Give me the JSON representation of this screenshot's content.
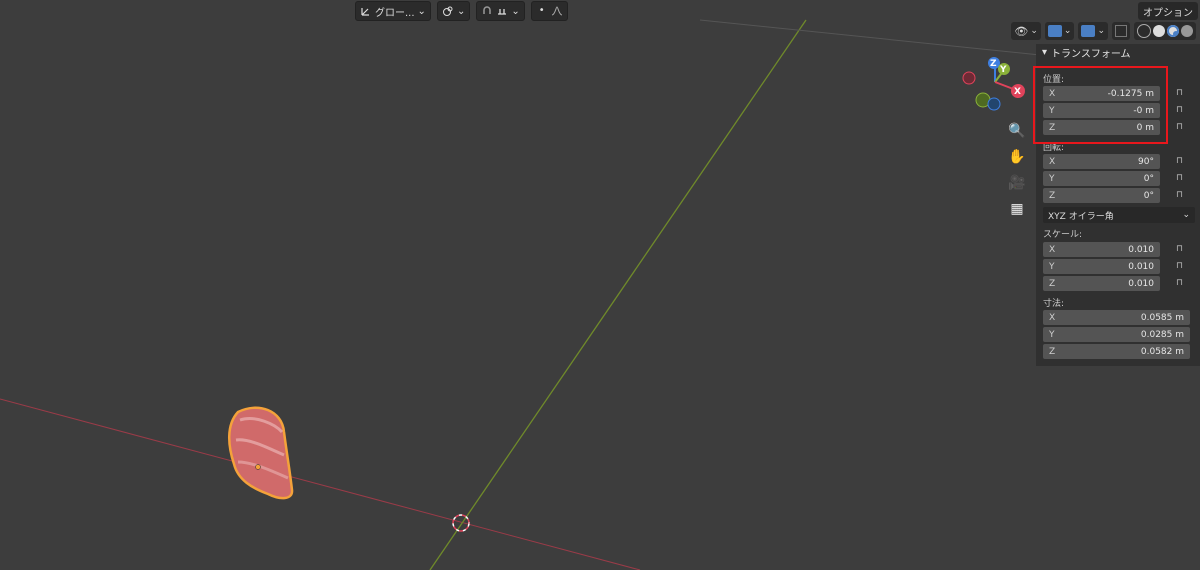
{
  "toolbar": {
    "orientation_label": "グロー...",
    "options_label": "オプション"
  },
  "panel": {
    "title": "トランスフォーム",
    "location": {
      "label": "位置:",
      "rows": [
        {
          "axis": "X",
          "value": "-0.1275 m"
        },
        {
          "axis": "Y",
          "value": "-0 m"
        },
        {
          "axis": "Z",
          "value": "0 m"
        }
      ]
    },
    "rotation": {
      "label": "回転:",
      "rows": [
        {
          "axis": "X",
          "value": "90°"
        },
        {
          "axis": "Y",
          "value": "0°"
        },
        {
          "axis": "Z",
          "value": "0°"
        }
      ],
      "mode": "XYZ オイラー角"
    },
    "scale": {
      "label": "スケール:",
      "rows": [
        {
          "axis": "X",
          "value": "0.010"
        },
        {
          "axis": "Y",
          "value": "0.010"
        },
        {
          "axis": "Z",
          "value": "0.010"
        }
      ]
    },
    "dimensions": {
      "label": "寸法:",
      "rows": [
        {
          "axis": "X",
          "value": "0.0585 m"
        },
        {
          "axis": "Y",
          "value": "0.0285 m"
        },
        {
          "axis": "Z",
          "value": "0.0582 m"
        }
      ]
    }
  },
  "gizmo": {
    "x": "X",
    "y": "Y",
    "z": "Z"
  },
  "colors": {
    "x_axis": "#e0435b",
    "y_axis": "#8bb23a",
    "z_axis": "#3e7fe0",
    "highlight": "#e8171c",
    "selection": "#f4a23a"
  }
}
